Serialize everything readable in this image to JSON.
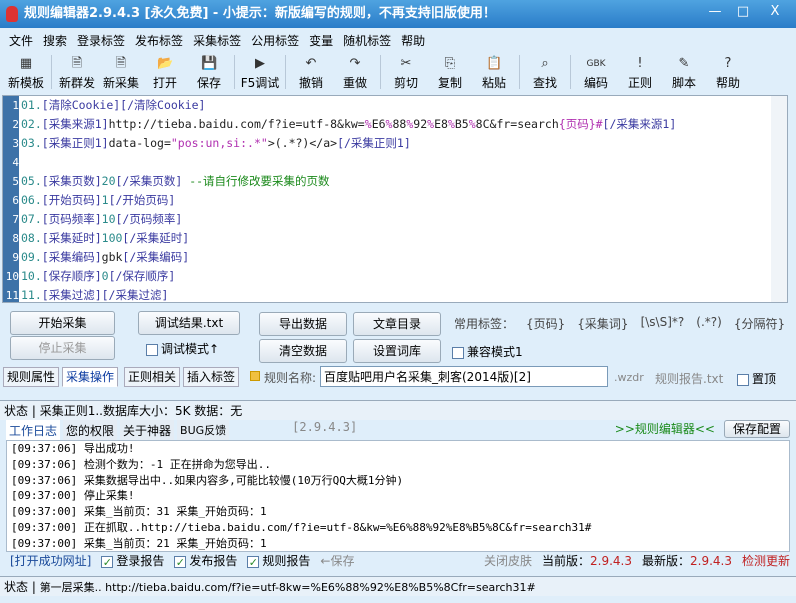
{
  "title": "规则编辑器2.9.4.3 [永久免费] - 小提示：新版编写的规则，不再支持旧版使用！",
  "window_buttons": [
    "—",
    "□",
    "X"
  ],
  "menu": [
    "文件",
    "搜索",
    "登录标签",
    "发布标签",
    "采集标签",
    "公用标签",
    "变量",
    "随机标签",
    "帮助"
  ],
  "toolbar": [
    {
      "label": "新模板",
      "icon": "grid-icon",
      "glyph": "▦"
    },
    {
      "label": "新群发",
      "icon": "new-doc-icon",
      "glyph": "🗎"
    },
    {
      "label": "新采集",
      "icon": "new-doc-icon",
      "glyph": "🗎"
    },
    {
      "label": "打开",
      "icon": "folder-open-icon",
      "glyph": "📂"
    },
    {
      "label": "保存",
      "icon": "floppy-icon",
      "glyph": "💾"
    },
    {
      "label": "F5调试",
      "icon": "play-icon",
      "glyph": "▶"
    },
    {
      "label": "撤销",
      "icon": "undo-icon",
      "glyph": "↶"
    },
    {
      "label": "重做",
      "icon": "redo-icon",
      "glyph": "↷"
    },
    {
      "label": "剪切",
      "icon": "scissors-icon",
      "glyph": "✂"
    },
    {
      "label": "复制",
      "icon": "copy-icon",
      "glyph": "⎘"
    },
    {
      "label": "粘贴",
      "icon": "paste-icon",
      "glyph": "📋"
    },
    {
      "label": "查找",
      "icon": "binoculars-icon",
      "glyph": "⌕"
    },
    {
      "label": "编码",
      "icon": "encoding-icon",
      "glyph": "GBK"
    },
    {
      "label": "正则",
      "icon": "regex-icon",
      "glyph": "!"
    },
    {
      "label": "脚本",
      "icon": "script-icon",
      "glyph": "✎"
    },
    {
      "label": "帮助",
      "icon": "help-icon",
      "glyph": "?"
    }
  ],
  "editor_lines": [
    [
      [
        "c-num",
        "01."
      ],
      [
        "c-tag",
        "[清除Cookie][/清除Cookie]"
      ]
    ],
    [
      [
        "c-num",
        "02."
      ],
      [
        "c-tag",
        "[采集来源1]"
      ],
      [
        "c-txt",
        "http://tieba.baidu.com/f?ie=utf-8&kw="
      ],
      [
        "c-mag",
        "%"
      ],
      [
        "c-txt",
        "E6"
      ],
      [
        "c-mag",
        "%"
      ],
      [
        "c-txt",
        "88"
      ],
      [
        "c-mag",
        "%"
      ],
      [
        "c-txt",
        "92"
      ],
      [
        "c-mag",
        "%"
      ],
      [
        "c-txt",
        "E8"
      ],
      [
        "c-mag",
        "%"
      ],
      [
        "c-txt",
        "B5"
      ],
      [
        "c-mag",
        "%"
      ],
      [
        "c-txt",
        "8C&fr=search"
      ],
      [
        "c-mag",
        "{页码}#"
      ],
      [
        "c-tag",
        "[/采集来源1]"
      ]
    ],
    [
      [
        "c-num",
        "03."
      ],
      [
        "c-tag",
        "[采集正则1]"
      ],
      [
        "c-txt",
        "data-log="
      ],
      [
        "c-mag",
        "\"pos:un,si:.*\""
      ],
      [
        "c-txt",
        ">(.*?)</a>"
      ],
      [
        "c-tag",
        "[/采集正则1]"
      ]
    ],
    [],
    [
      [
        "c-num",
        "05."
      ],
      [
        "c-tag",
        "[采集页数]"
      ],
      [
        "c-num",
        "20"
      ],
      [
        "c-tag",
        "[/采集页数]"
      ],
      [
        "c-cmt",
        " --请自行修改要采集的页数"
      ]
    ],
    [
      [
        "c-num",
        "06."
      ],
      [
        "c-tag",
        "[开始页码]"
      ],
      [
        "c-num",
        "1"
      ],
      [
        "c-tag",
        "[/开始页码]"
      ]
    ],
    [
      [
        "c-num",
        "07."
      ],
      [
        "c-tag",
        "[页码频率]"
      ],
      [
        "c-num",
        "10"
      ],
      [
        "c-tag",
        "[/页码频率]"
      ]
    ],
    [
      [
        "c-num",
        "08."
      ],
      [
        "c-tag",
        "[采集延时]"
      ],
      [
        "c-num",
        "100"
      ],
      [
        "c-tag",
        "[/采集延时]"
      ]
    ],
    [
      [
        "c-num",
        "09."
      ],
      [
        "c-tag",
        "[采集编码]"
      ],
      [
        "c-txt",
        "gbk"
      ],
      [
        "c-tag",
        "[/采集编码]"
      ]
    ],
    [
      [
        "c-num",
        "10."
      ],
      [
        "c-tag",
        "[保存顺序]"
      ],
      [
        "c-num",
        "0"
      ],
      [
        "c-tag",
        "[/保存顺序]"
      ]
    ],
    [
      [
        "c-num",
        "11."
      ],
      [
        "c-tag",
        "[采集过滤][/采集过滤]"
      ]
    ]
  ],
  "buttons": {
    "start": "开始采集",
    "stop": "停止采集",
    "debug_result": "调试结果.txt",
    "debug_mode": "调试模式↑",
    "export": "导出数据",
    "clear": "清空数据",
    "article_dir": "文章目录",
    "wordlib": "设置词库",
    "compat": "兼容模式1"
  },
  "common_tags": {
    "label": "常用标签：",
    "items": [
      "{页码}",
      "{采集词}",
      "[\\s\\S]*?",
      "(.*?)",
      "{分隔符}"
    ]
  },
  "tabs": [
    "规则属性",
    "采集操作",
    "正则相关",
    "插入标签"
  ],
  "rule_name": {
    "label": "规则名称:",
    "value": "百度贴吧用户名采集_刺客(2014版)[2]",
    "ext": ".wzdr",
    "report": "规则报告.txt",
    "pin": "置顶"
  },
  "status1": {
    "label": "状态",
    "text": "采集正则1..数据库大小：5K 数据：无"
  },
  "bottom_tabs": [
    "工作日志",
    "您的权限",
    "关于神器",
    "BUG反馈"
  ],
  "version_tag": "[2.9.4.3]",
  "editor_link": ">>规则编辑器<<",
  "save_config": "保存配置",
  "log": [
    "[09:37:06] 导出成功!",
    "[09:37:06] 检测个数为：-1 正在拼命为您导出..",
    "[09:37:06] 采集数据导出中..如果内容多,可能比较慢(10万行QQ大概1分钟)",
    "[09:37:00] 停止采集!",
    "[09:37:00] 采集_当前页：31 采集_开始页码：1",
    "[09:37:00] 正在抓取..http://tieba.baidu.com/f?ie=utf-8&kw=%E6%88%92%E8%B5%8C&fr=search31#",
    "[09:37:00] 采集_当前页：21 采集_开始页码：1"
  ],
  "footer": {
    "open_url": "[打开成功网址]",
    "login_report": "登录报告",
    "publish_report": "发布报告",
    "rule_report": "规则报告",
    "save": "←保存",
    "close_skin": "关闭皮肤",
    "current_label": "当前版：",
    "current": "2.9.4.3",
    "latest_label": "最新版：",
    "latest": "2.9.4.3",
    "check": "检测更新"
  },
  "status2": {
    "label": "状态",
    "text": "第一层采集.. http://tieba.baidu.com/f?ie=utf-8kw=%E6%88%92%E8%B5%8Cfr=search31#"
  }
}
